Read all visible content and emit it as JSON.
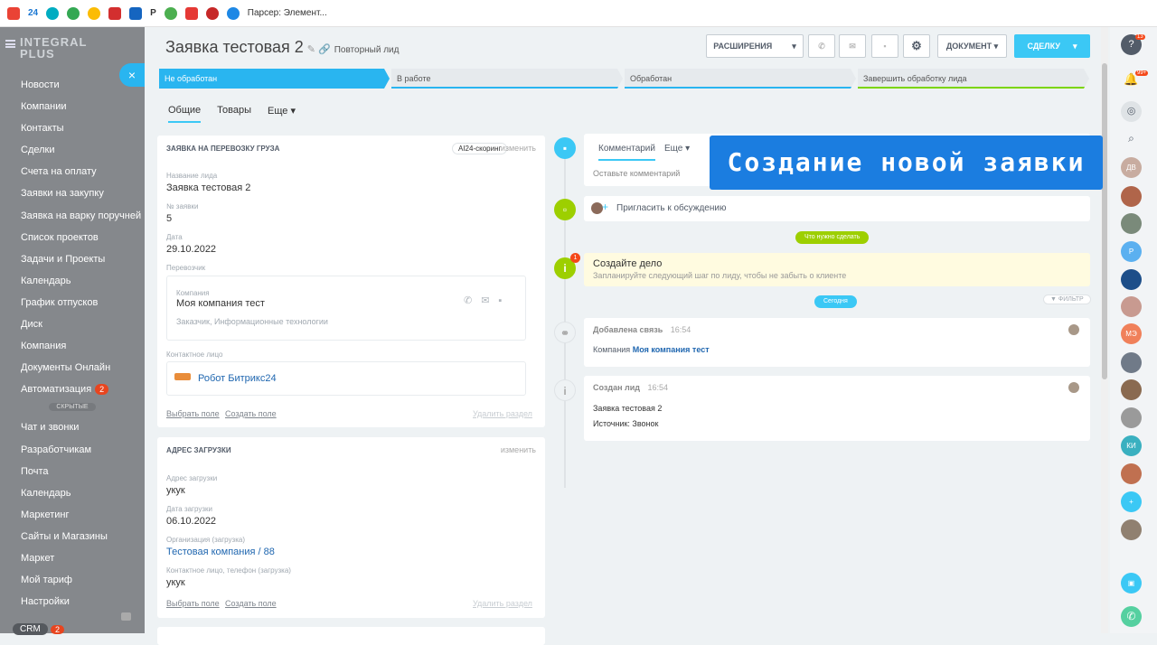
{
  "bookmarks": {
    "n24": "24",
    "p": "P",
    "parser": "Парсер: Элемент..."
  },
  "sidebar": {
    "logo_line1": "INTEGRAL",
    "logo_line2": "PLUS",
    "items": [
      "Новости",
      "Компании",
      "Контакты",
      "Сделки",
      "Счета на оплату",
      "Заявки на закупку",
      "Заявка на варку поручней",
      "Список проектов",
      "Задачи и Проекты",
      "Календарь",
      "График отпусков",
      "Диск",
      "Компания",
      "Документы Онлайн",
      "Автоматизация"
    ],
    "automation_badge": "2",
    "hidden_label": "СКРЫТЫЕ",
    "hidden_items": [
      "Чат и звонки",
      "Разработчикам",
      "Почта",
      "Календарь",
      "Маркетинг",
      "Сайты и Магазины",
      "Маркет",
      "Мой тариф",
      "Настройки"
    ],
    "crm": "CRM",
    "crm_badge": "2"
  },
  "header": {
    "title": "Заявка тестовая 2",
    "subtitle": "Повторный лид",
    "ext": "РАСШИРЕНИЯ",
    "doc": "ДОКУМЕНТ",
    "deal": "СДЕЛКУ"
  },
  "stages": [
    "Не обработан",
    "В работе",
    "Обработан",
    "Завершить обработку лида"
  ],
  "tabs": [
    "Общие",
    "Товары",
    "Еще"
  ],
  "card1": {
    "title": "ЗАЯВКА НА ПЕРЕВОЗКУ ГРУЗА",
    "scoring": "AI24-скоринг",
    "edit": "изменить",
    "f1_l": "Название лида",
    "f1_v": "Заявка тестовая 2",
    "f2_l": "№ заявки",
    "f2_v": "5",
    "f3_l": "Дата",
    "f3_v": "29.10.2022",
    "carrier": "Перевозчик",
    "company_l": "Компания",
    "company_v": "Моя компания тест",
    "company_d": "Заказчик, Информационные технологии",
    "contact_l": "Контактное лицо",
    "contact_v": "Робот Битрикс24",
    "choose": "Выбрать поле",
    "create": "Создать поле",
    "delete": "Удалить раздел"
  },
  "card2": {
    "title": "АДРЕС ЗАГРУЗКИ",
    "edit": "изменить",
    "f1_l": "Адрес загрузки",
    "f1_v": "укук",
    "f2_l": "Дата загрузки",
    "f2_v": "06.10.2022",
    "f3_l": "Организация (загрузка)",
    "f3_v": "Тестовая компания / 88",
    "f4_l": "Контактное лицо, телефон (загрузка)",
    "f4_v": "укук",
    "choose": "Выбрать поле",
    "create": "Создать поле",
    "delete": "Удалить раздел"
  },
  "timeline": {
    "comment_tab": "Комментарий",
    "more": "Еще",
    "comment_ph": "Оставьте комментарий",
    "invite": "Пригласить к обсуждению",
    "todo_tag": "Что нужно сделать",
    "task_title": "Создайте дело",
    "task_sub": "Запланируйте следующий шаг по лиду, чтобы не забыть о клиенте",
    "today": "Сегодня",
    "filter": "ФИЛЬТР",
    "e1_title": "Добавлена связь",
    "e1_time": "16:54",
    "e1_l": "Компания",
    "e1_v": "Моя компания тест",
    "e2_title": "Создан лид",
    "e2_time": "16:54",
    "e2_l1": "Заявка тестовая 2",
    "e2_l2": "Источник: Звонок",
    "task_badge": "1"
  },
  "overlay": "Создание новой заявки",
  "right": {
    "help_badge": "13",
    "bell_badge": "99+",
    "av_dv": "ДВ",
    "av_p": "Р",
    "av_me": "МЭ",
    "av_ki": "КИ"
  }
}
